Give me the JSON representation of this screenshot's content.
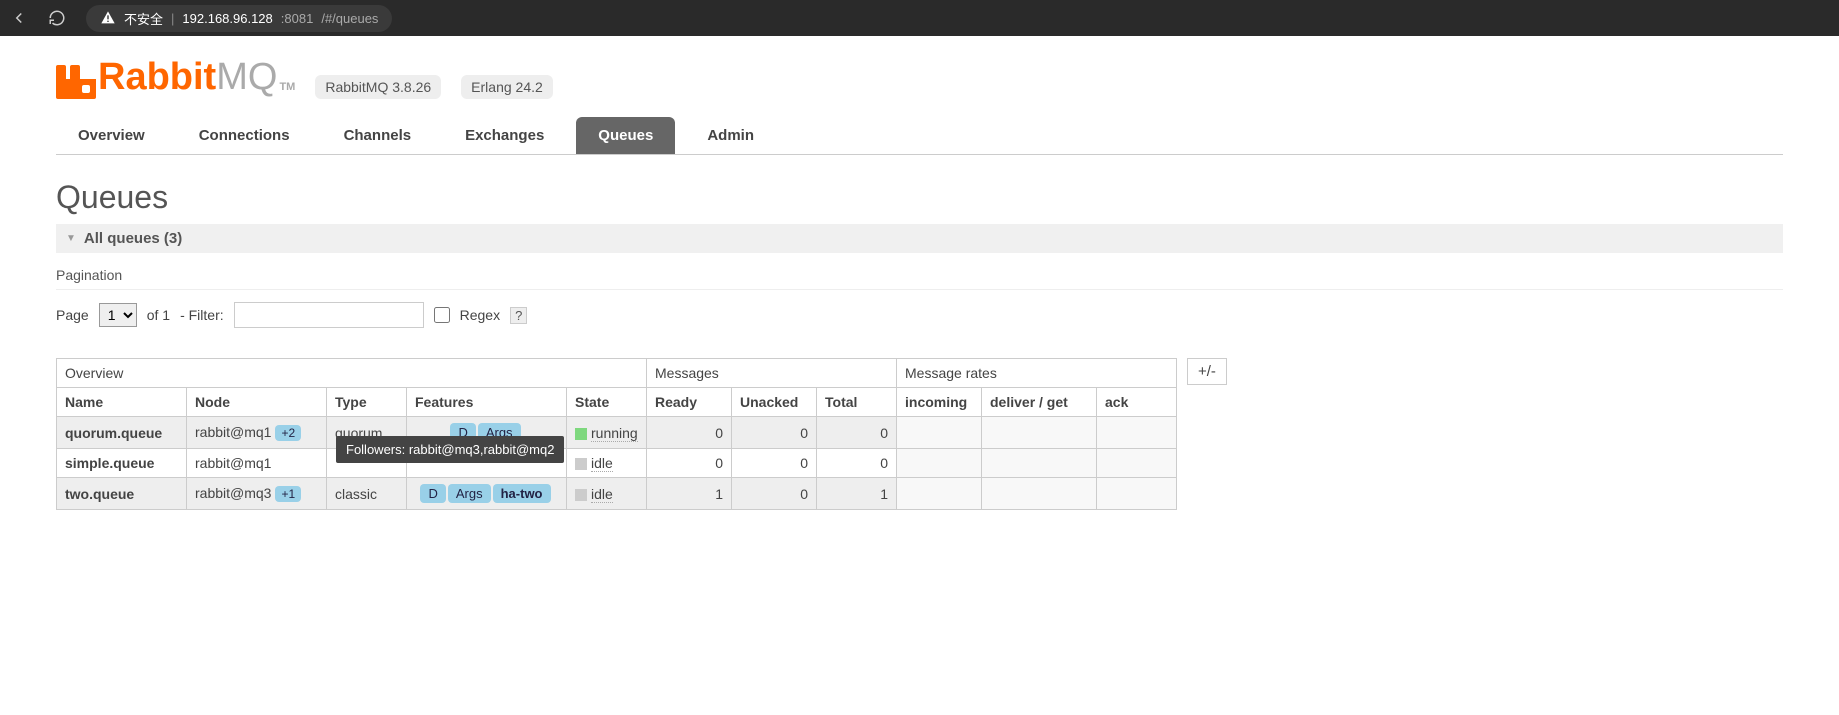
{
  "browser": {
    "insecure_label": "不安全",
    "url_host": "192.168.96.128",
    "url_port": ":8081",
    "url_path": "/#/queues"
  },
  "header": {
    "logo_rabbit": "Rabbit",
    "logo_mq": "MQ",
    "logo_tm": "TM",
    "version_rabbit": "RabbitMQ 3.8.26",
    "version_erlang": "Erlang 24.2"
  },
  "tabs": {
    "overview": "Overview",
    "connections": "Connections",
    "channels": "Channels",
    "exchanges": "Exchanges",
    "queues": "Queues",
    "admin": "Admin"
  },
  "page": {
    "title": "Queues",
    "section_title": "All queues (3)",
    "pagination_label": "Pagination",
    "page_label": "Page",
    "page_current": "1",
    "page_of": "of 1",
    "filter_label": "- Filter:",
    "filter_value": "",
    "regex_label": "Regex",
    "regex_help": "?",
    "plusminus": "+/-"
  },
  "tooltip": "Followers: rabbit@mq3,rabbit@mq2",
  "table": {
    "groups": {
      "overview": "Overview",
      "messages": "Messages",
      "rates": "Message rates"
    },
    "cols": {
      "name": "Name",
      "node": "Node",
      "type": "Type",
      "features": "Features",
      "state": "State",
      "ready": "Ready",
      "unacked": "Unacked",
      "total": "Total",
      "incoming": "incoming",
      "deliver": "deliver / get",
      "ack": "ack"
    },
    "rows": [
      {
        "name": "quorum.queue",
        "node": "rabbit@mq1",
        "node_plus": "+2",
        "type": "quorum",
        "features": [
          "D",
          "Args"
        ],
        "state": "running",
        "state_kind": "running",
        "ready": "0",
        "unacked": "0",
        "total": "0"
      },
      {
        "name": "simple.queue",
        "node": "rabbit@mq1",
        "node_plus": "",
        "type": "",
        "features": [],
        "state": "idle",
        "state_kind": "idle",
        "ready": "0",
        "unacked": "0",
        "total": "0"
      },
      {
        "name": "two.queue",
        "node": "rabbit@mq3",
        "node_plus": "+1",
        "type": "classic",
        "features": [
          "D",
          "Args",
          "ha-two"
        ],
        "state": "idle",
        "state_kind": "idle",
        "ready": "1",
        "unacked": "0",
        "total": "1"
      }
    ]
  }
}
